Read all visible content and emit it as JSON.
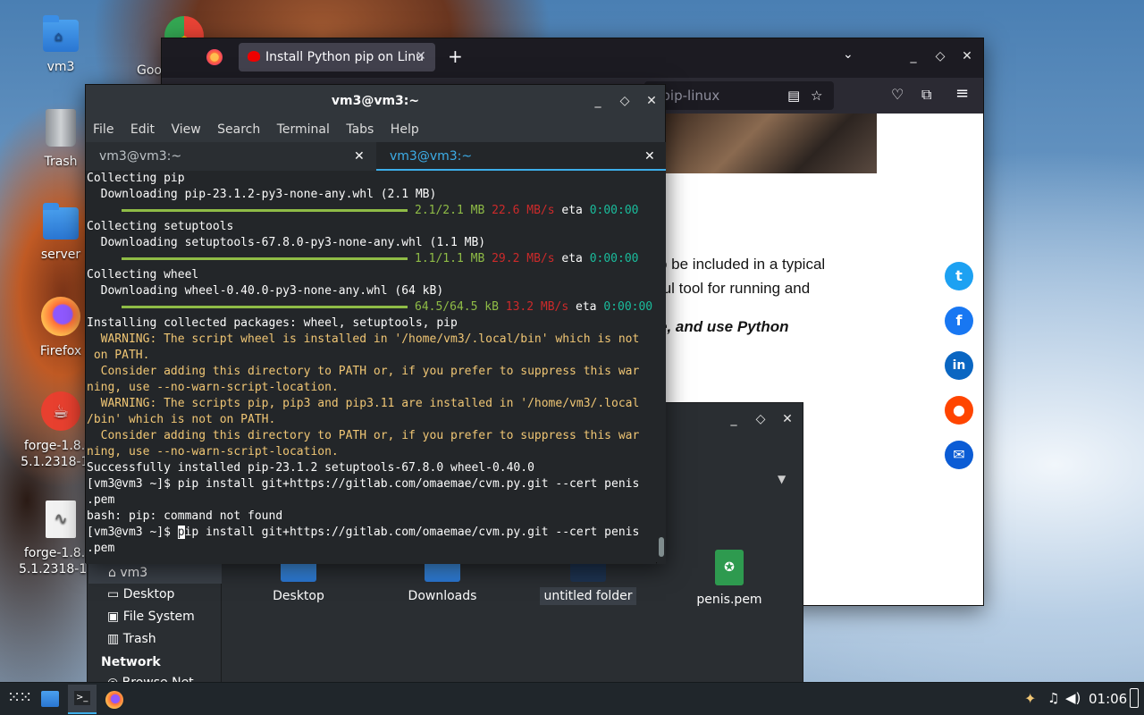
{
  "desktop": {
    "icons": [
      {
        "label": "vm3",
        "icon": "home-folder-icon"
      },
      {
        "label": "Trash",
        "icon": "trash-icon"
      },
      {
        "label": "server",
        "icon": "folder-icon"
      },
      {
        "label": "Firefox",
        "icon": "firefox-icon"
      },
      {
        "label": "forge-1.8.9-\n5.1.2318-1.8",
        "icon": "java-icon"
      },
      {
        "label": "forge-1.8.9-\n5.1.2318-1.8.",
        "icon": "file-icon"
      },
      {
        "label": "Goo",
        "icon": "chrome-icon"
      }
    ]
  },
  "firefox": {
    "tab_title": "Install Python pip on Linu",
    "url_fragment": "-pip-linux",
    "article_lines": [
      "o be included in a typical",
      "ful tool for running and"
    ],
    "article_bold": "e, and use Python",
    "social_colors": {
      "twitter": "#1da1f2",
      "facebook": "#1877f2",
      "linkedin": "#0a66c2",
      "reddit": "#ff4500",
      "email": "#0b5cd5"
    }
  },
  "terminal": {
    "title": "vm3@vm3:~",
    "menu": [
      "File",
      "Edit",
      "View",
      "Search",
      "Terminal",
      "Tabs",
      "Help"
    ],
    "tabs": [
      "vm3@vm3:~",
      "vm3@vm3:~"
    ],
    "lines": {
      "l1": "Collecting pip",
      "l2": "  Downloading pip-23.1.2-py3-none-any.whl (2.1 MB)",
      "p1a": "2.1/2.1 MB",
      "p1b": "22.6 MB/s",
      "p1c": "eta",
      "p1d": "0:00:00",
      "l3": "Collecting setuptools",
      "l4": "  Downloading setuptools-67.8.0-py3-none-any.whl (1.1 MB)",
      "p2a": "1.1/1.1 MB",
      "p2b": "29.2 MB/s",
      "p2c": "eta",
      "p2d": "0:00:00",
      "l5": "Collecting wheel",
      "l6": "  Downloading wheel-0.40.0-py3-none-any.whl (64 kB)",
      "p3a": "64.5/64.5 kB",
      "p3b": "13.2 MB/s",
      "p3c": "eta",
      "p3d": "0:00:00",
      "l7": "Installing collected packages: wheel, setuptools, pip",
      "w1": "  WARNING: The script wheel is installed in '/home/vm3/.local/bin' which is not\n on PATH.",
      "w2": "  Consider adding this directory to PATH or, if you prefer to suppress this war\nning, use --no-warn-script-location.",
      "w3": "  WARNING: The scripts pip, pip3 and pip3.11 are installed in '/home/vm3/.local\n/bin' which is not on PATH.",
      "w4": "  Consider adding this directory to PATH or, if you prefer to suppress this war\nning, use --no-warn-script-location.",
      "l8": "Successfully installed pip-23.1.2 setuptools-67.8.0 wheel-0.40.0",
      "l9": "[vm3@vm3 ~]$ pip install git+https://gitlab.com/omaemae/cvm.py.git --cert penis\n.pem",
      "l10": "bash: pip: command not found",
      "l11a": "[vm3@vm3 ~]$ ",
      "l11b": "p",
      "l11c": "ip install git+https://gitlab.com/omaemae/cvm.py.git --cert penis\n.pem"
    }
  },
  "filemanager": {
    "sidebar": [
      "vm3",
      "Desktop",
      "File System",
      "Trash"
    ],
    "network_heading": "Network",
    "network_item": "Browse Net",
    "files": [
      "Desktop",
      "Downloads",
      "untitled folder",
      "penis.pem"
    ]
  },
  "taskbar": {
    "clock": "01:06"
  }
}
